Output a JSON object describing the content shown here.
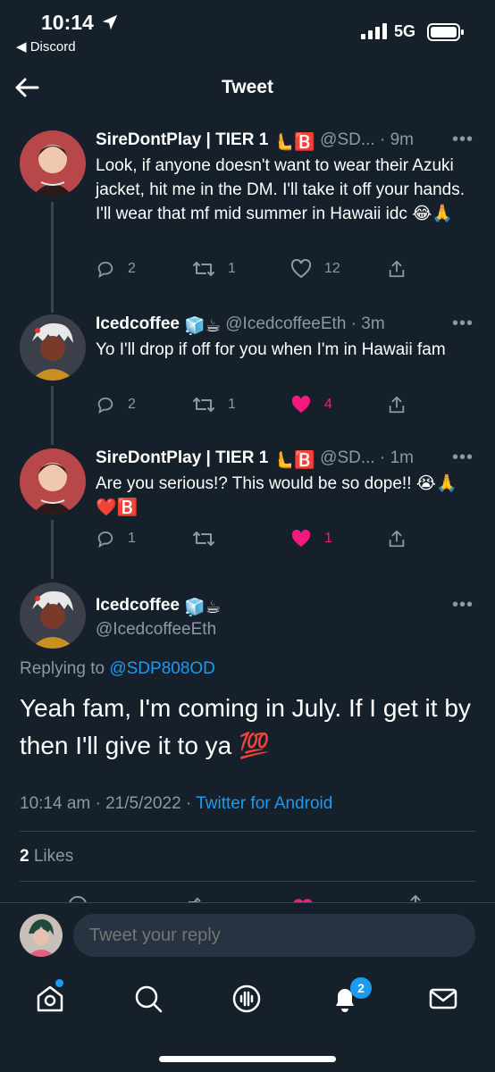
{
  "status": {
    "time": "10:14",
    "back_app": "◀ Discord",
    "network": "5G"
  },
  "header": {
    "title": "Tweet"
  },
  "tweets": [
    {
      "name": "SireDontPlay | TIER 1",
      "name_emoji": "🫷🅱️",
      "handle": "@SD...",
      "time": "· 9m",
      "text": "Look, if anyone doesn't want to wear their Azuki jacket, hit me in the DM. I'll take it off your hands. I'll wear that mf mid summer in Hawaii idc 😂🙏",
      "replies": "2",
      "retweets": "1",
      "likes": "12"
    },
    {
      "name": "Icedcoffee",
      "name_emoji": "🧊☕",
      "handle": "@IcedcoffeeEth",
      "time": "· 3m",
      "text": "Yo I'll drop if off for you when I'm in Hawaii fam",
      "replies": "2",
      "retweets": "1",
      "likes": "4"
    },
    {
      "name": "SireDontPlay | TIER 1",
      "name_emoji": "🫷🅱️",
      "handle": "@SD...",
      "time": "· 1m",
      "text": "Are you serious!? This would be so dope!! 😭🙏❤️🅱️",
      "replies": "1",
      "retweets": "",
      "likes": "1"
    }
  ],
  "main_tweet": {
    "name": "Icedcoffee",
    "name_emoji": "🧊☕",
    "handle": "@IcedcoffeeEth",
    "replying_prefix": "Replying to",
    "replying_to": "@SDP808OD",
    "text": "Yeah fam, I'm coming in July. If I get it by then I'll give it to ya 💯",
    "timestamp": "10:14 am · 21/5/2022 ·",
    "source": "Twitter for Android",
    "likes_count": "2",
    "likes_label": "Likes"
  },
  "reply": {
    "placeholder": "Tweet your reply"
  },
  "tabbar": {
    "notification_badge": "2"
  },
  "colors": {
    "background": "#15202b",
    "accent": "#1d9bf0",
    "like": "#f91880",
    "muted": "#8b98a5",
    "divider": "#38444d"
  }
}
